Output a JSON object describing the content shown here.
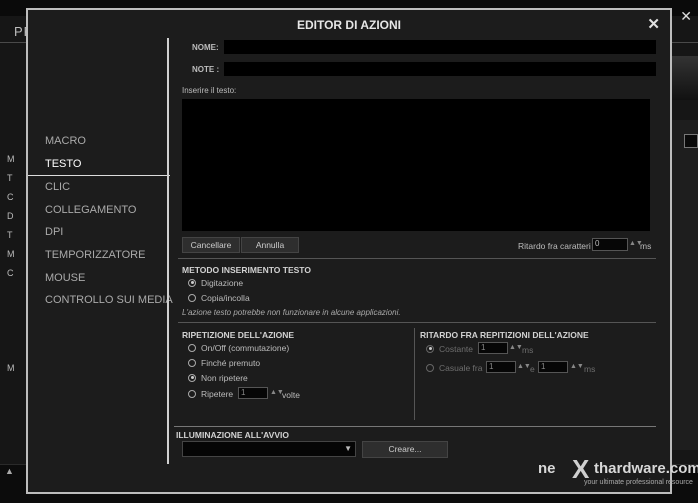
{
  "background": {
    "tab_label": "PR",
    "left_letters": [
      "M",
      "T",
      "C",
      "D",
      "T",
      "M",
      "C",
      "",
      "",
      "",
      "",
      "M"
    ],
    "close_glyph": "✕"
  },
  "dialog": {
    "title": "EDITOR DI AZIONI",
    "close_glyph": "✕",
    "sidebar": {
      "items": [
        {
          "label": "MACRO",
          "active": false
        },
        {
          "label": "TESTO",
          "active": true
        },
        {
          "label": "CLIC",
          "active": false
        },
        {
          "label": "COLLEGAMENTO",
          "active": false
        },
        {
          "label": "DPI",
          "active": false
        },
        {
          "label": "TEMPORIZZATORE",
          "active": false
        },
        {
          "label": "MOUSE",
          "active": false
        },
        {
          "label": "CONTROLLO SUI MEDIA",
          "active": false
        }
      ]
    },
    "name_label": "NOME:",
    "name_value": "",
    "note_label": "NOTE :",
    "note_value": "",
    "text_label": "Inserire il testo:",
    "text_value": "",
    "cancel_button": "Cancellare",
    "undo_button": "Annulla",
    "char_delay_label": "Ritardo fra caratteri",
    "char_delay_value": "0",
    "char_delay_unit": "ms",
    "spin_arrows": "▲▼",
    "input_method": {
      "title": "METODO INSERIMENTO TESTO",
      "options": [
        "Digitazione",
        "Copia/incolla"
      ],
      "selected": "Digitazione",
      "note": "L'azione testo potrebbe non funzionare in alcune applicazioni."
    },
    "repeat": {
      "title": "RIPETIZIONE DELL'AZIONE",
      "options": [
        "On/Off (commutazione)",
        "Finché premuto",
        "Non ripetere",
        "Ripetere"
      ],
      "selected": "Non ripetere",
      "repeat_count": "1",
      "repeat_unit": "volte"
    },
    "repeat_delay": {
      "title": "RITARDO FRA REPITIZIONI DELL'AZIONE",
      "constant_label": "Costante",
      "constant_value": "1",
      "constant_unit": "ms",
      "random_label": "Casuale fra",
      "random_min": "1",
      "random_sep": "e",
      "random_max": "1",
      "random_unit": "ms",
      "selected": "Costante",
      "enabled": false
    },
    "lighting": {
      "title": "ILLUMINAZIONE ALL'AVVIO",
      "select_value": "",
      "dropdown_glyph": "▼",
      "create_button": "Creare..."
    }
  },
  "watermark": {
    "ne": "ne",
    "x": "X",
    "t": "thardware.com",
    "tagline": "your ultimate professional resource"
  },
  "colors": {
    "dialog_bg": "#1c1c1c",
    "field_bg": "#000000",
    "border": "#bdbdbd"
  }
}
